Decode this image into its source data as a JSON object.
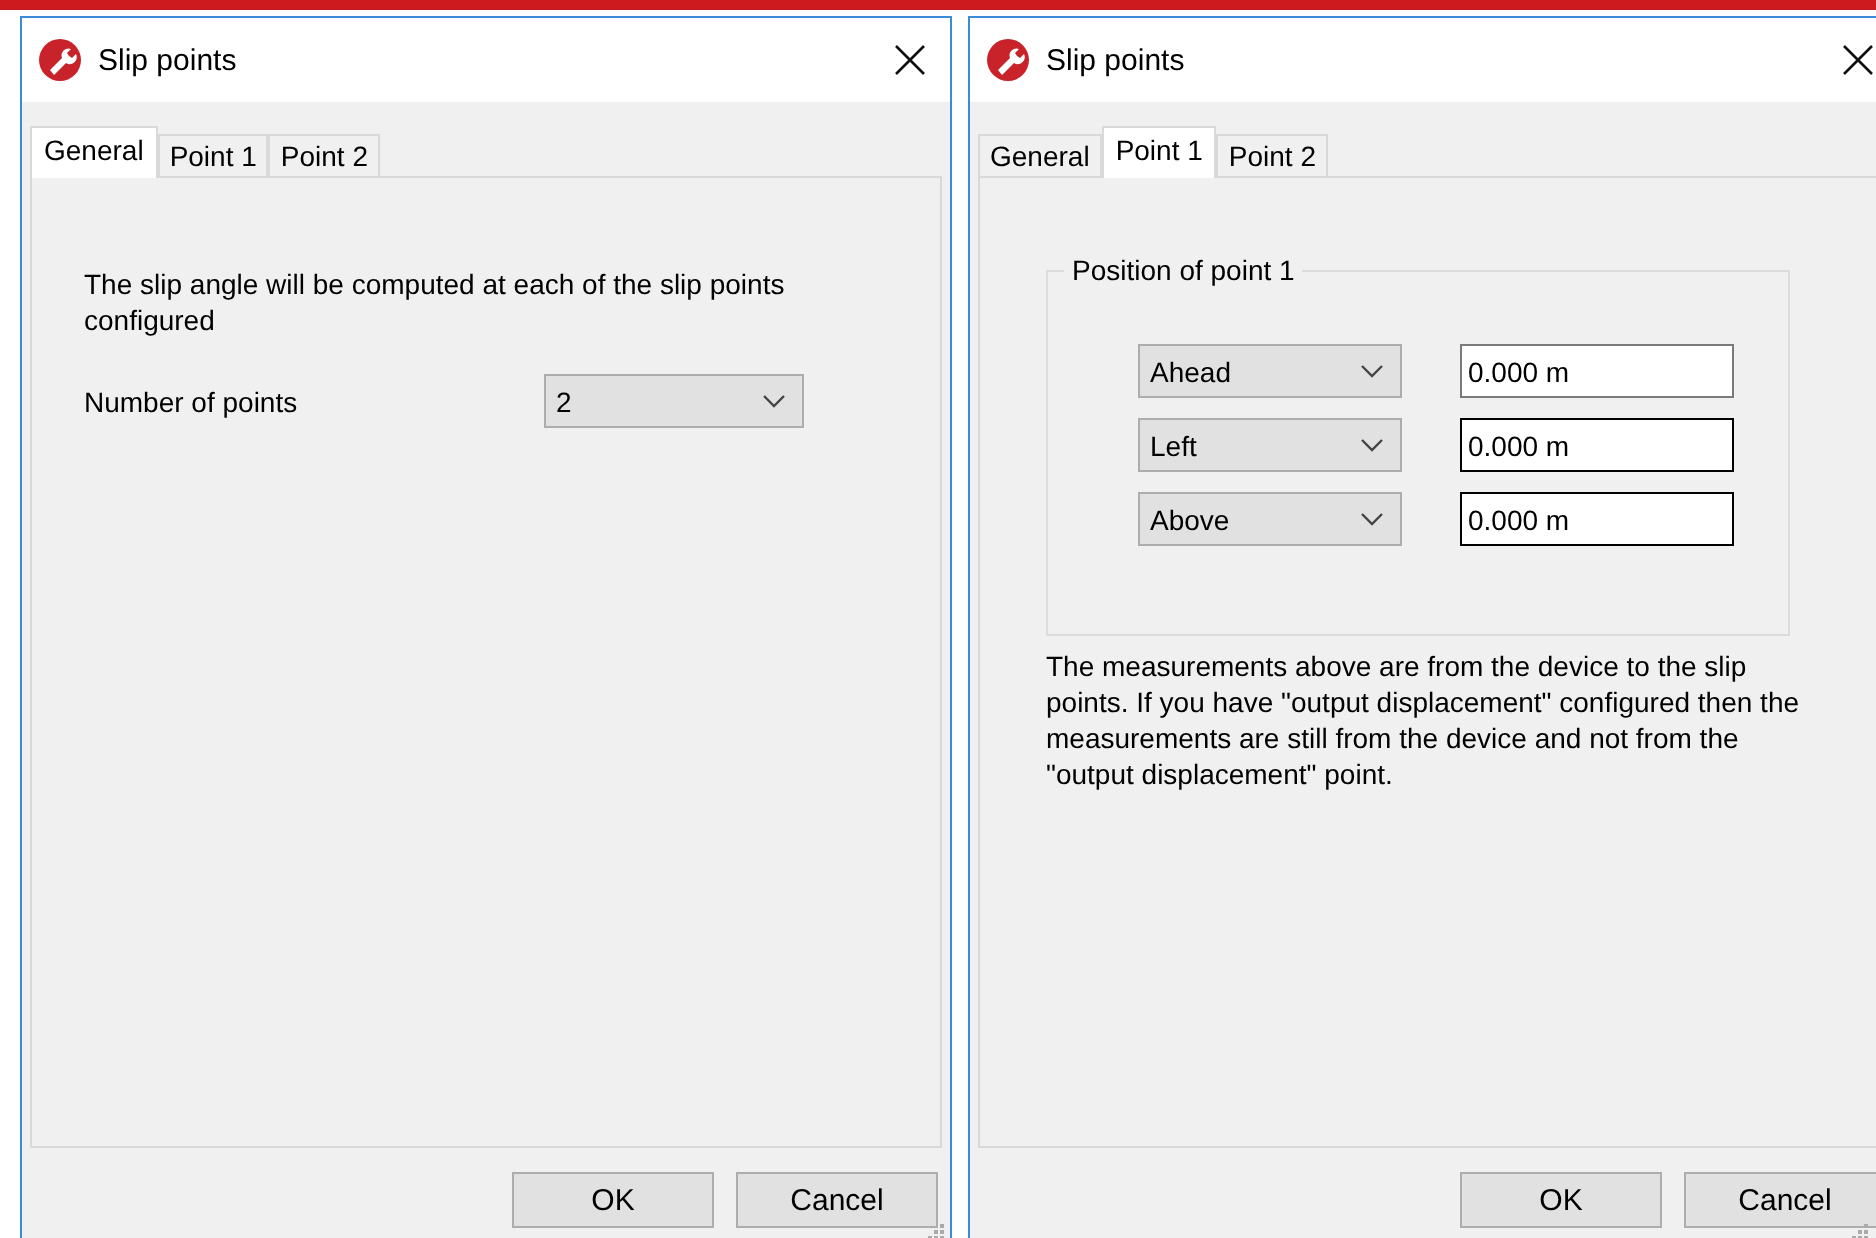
{
  "dialogs": [
    {
      "kind": "general",
      "title": "Slip points",
      "tabs": [
        {
          "label": "General",
          "selected": true
        },
        {
          "label": "Point 1",
          "selected": false
        },
        {
          "label": "Point 2",
          "selected": false
        }
      ],
      "description": "The slip angle will be computed at each of the slip points configured",
      "number_label": "Number of points",
      "number_value": "2",
      "buttons": [
        "OK",
        "Cancel"
      ]
    },
    {
      "kind": "point",
      "title": "Slip points",
      "tabs": [
        {
          "label": "General",
          "selected": false
        },
        {
          "label": "Point 1",
          "selected": true
        },
        {
          "label": "Point 2",
          "selected": false
        }
      ],
      "group_title": "Position of point 1",
      "rows": [
        {
          "direction": "Ahead",
          "value": "0.000 m",
          "focused": false
        },
        {
          "direction": "Left",
          "value": "0.000 m",
          "focused": true
        },
        {
          "direction": "Above",
          "value": "0.000 m",
          "focused": true
        }
      ],
      "note": "The measurements above are from the device to the slip points. If you have \"output displacement\" configured then the measurements are still from the device and not from the \"output displacement\" point.",
      "buttons": [
        "OK",
        "Cancel"
      ]
    }
  ]
}
